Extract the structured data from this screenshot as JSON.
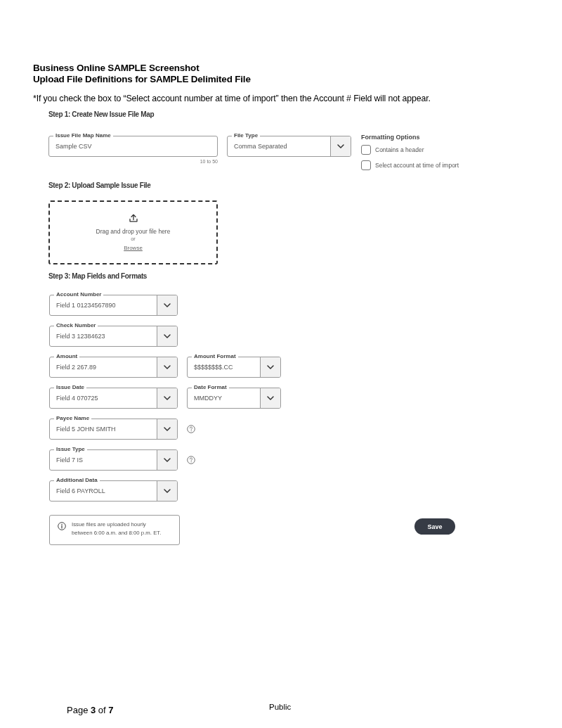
{
  "header": {
    "title_lines": [
      "Business Online SAMPLE Screenshot",
      "Upload File Definitions for SAMPLE Delimited File"
    ],
    "note": "*If you check the box to “Select account number at time of import” then the Account # Field will not appear."
  },
  "step1": {
    "heading": "Step 1: Create New Issue File Map",
    "name_field": {
      "label": "Issue File Map Name",
      "value": "Sample CSV",
      "hint": "10 to 50"
    },
    "file_type": {
      "label": "File Type",
      "value": "Comma Separated"
    },
    "formatting_options": {
      "heading": "Formatting Options",
      "options": [
        {
          "label": "Contains a header",
          "checked": false
        },
        {
          "label": "Select account at time of import",
          "checked": false
        }
      ]
    }
  },
  "step2": {
    "heading": "Step 2: Upload Sample Issue File",
    "dropzone": {
      "prompt": "Drag and drop your file here",
      "separator": "or",
      "link": "Browse"
    }
  },
  "step3": {
    "heading": "Step 3: Map Fields and Formats",
    "rows": [
      {
        "fields": [
          {
            "label": "Account Number",
            "value": "Field 1 01234567890"
          }
        ],
        "help": false
      },
      {
        "fields": [
          {
            "label": "Check Number",
            "value": "Field 3 12384623"
          }
        ],
        "help": false
      },
      {
        "fields": [
          {
            "label": "Amount",
            "value": "Field 2 267.89"
          },
          {
            "label": "Amount Format",
            "value": "$$$$$$$$.CC"
          }
        ],
        "help": false
      },
      {
        "fields": [
          {
            "label": "Issue Date",
            "value": "Field 4 070725"
          },
          {
            "label": "Date Format",
            "value": "MMDDYY"
          }
        ],
        "help": false
      },
      {
        "fields": [
          {
            "label": "Payee Name",
            "value": "Field 5 JOHN SMITH"
          }
        ],
        "help": true
      },
      {
        "fields": [
          {
            "label": "Issue Type",
            "value": "Field 7 IS"
          }
        ],
        "help": true
      },
      {
        "fields": [
          {
            "label": "Additional Data",
            "value": "Field 6 PAYROLL"
          }
        ],
        "help": false
      }
    ]
  },
  "info": {
    "text": "Issue files are uploaded hourly between 6:00 a.m. and 8:00 p.m. ET."
  },
  "save_button": {
    "label": "Save"
  },
  "footer": {
    "page": "Page **3** of **7**",
    "classification": "Public"
  }
}
